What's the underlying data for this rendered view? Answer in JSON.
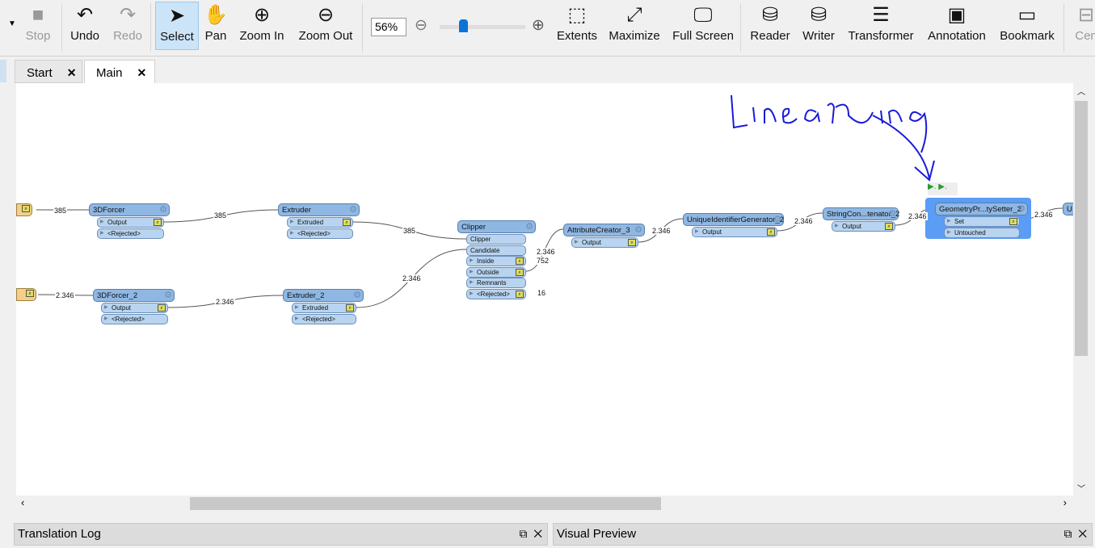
{
  "toolbar": {
    "items": [
      {
        "label": "Stop",
        "icon": "stop-icon",
        "disabled": true
      },
      {
        "label": "Undo",
        "icon": "undo-icon"
      },
      {
        "label": "Redo",
        "icon": "redo-icon",
        "disabled": true
      },
      {
        "label": "Select",
        "icon": "cursor-icon",
        "active": true
      },
      {
        "label": "Pan",
        "icon": "hand-icon"
      },
      {
        "label": "Zoom In",
        "icon": "zoom-in-icon"
      },
      {
        "label": "Zoom Out",
        "icon": "zoom-out-icon"
      },
      {
        "label": "Extents",
        "icon": "extents-icon"
      },
      {
        "label": "Maximize",
        "icon": "maximize-icon"
      },
      {
        "label": "Full Screen",
        "icon": "full-screen-icon"
      },
      {
        "label": "Reader",
        "icon": "add-reader-icon"
      },
      {
        "label": "Writer",
        "icon": "add-writer-icon"
      },
      {
        "label": "Transformer",
        "icon": "add-transformer-icon"
      },
      {
        "label": "Annotation",
        "icon": "add-annotation-icon"
      },
      {
        "label": "Bookmark",
        "icon": "add-bookmark-icon"
      },
      {
        "label": "Cen",
        "icon": "center-icon",
        "disabled": true
      }
    ],
    "zoom": {
      "value": "56%",
      "level": 0.56
    }
  },
  "tabs": [
    {
      "label": "Start"
    },
    {
      "label": "Main",
      "active": true
    }
  ],
  "annotation": {
    "handwritten": "linearRing",
    "color": "#1a1adb"
  },
  "nodes": [
    {
      "name": "3DForcer",
      "outputs": [
        "Output",
        "<Rejected>"
      ]
    },
    {
      "name": "Extruder",
      "outputs": [
        "Extruded",
        "<Rejected>"
      ]
    },
    {
      "name": "3DForcer_2",
      "outputs": [
        "Output",
        "<Rejected>"
      ]
    },
    {
      "name": "Extruder_2",
      "outputs": [
        "Extruded",
        "<Rejected>"
      ]
    },
    {
      "name": "Clipper",
      "inputs": [
        "Clipper",
        "Candidate"
      ],
      "outputs": [
        "Inside",
        "Outside",
        "Remnants",
        "<Rejected>"
      ]
    },
    {
      "name": "AttributeCreator_3",
      "outputs": [
        "Output"
      ]
    },
    {
      "name": "UniqueIdentifierGenerator_2",
      "outputs": [
        "Output"
      ]
    },
    {
      "name": "StringCon...tenator_2",
      "outputs": [
        "Output"
      ]
    },
    {
      "name": "GeometryPr...tySetter_2",
      "outputs": [
        "Set",
        "Untouched"
      ],
      "selected": true
    },
    {
      "name": "U",
      "outputs": []
    }
  ],
  "counts": [
    "385",
    "385",
    "385",
    "2.346",
    "2.346",
    "2.346",
    "2.346",
    "752",
    "16",
    "2.346",
    "2.346",
    "2.346",
    "2.346"
  ],
  "panels": [
    {
      "title": "Translation Log"
    },
    {
      "title": "Visual Preview"
    }
  ],
  "colors": {
    "node_header": "#8fb7e3",
    "node_port": "#b8d4f0",
    "selection": "#5b9cf5",
    "reader": "#f5cf8a"
  }
}
